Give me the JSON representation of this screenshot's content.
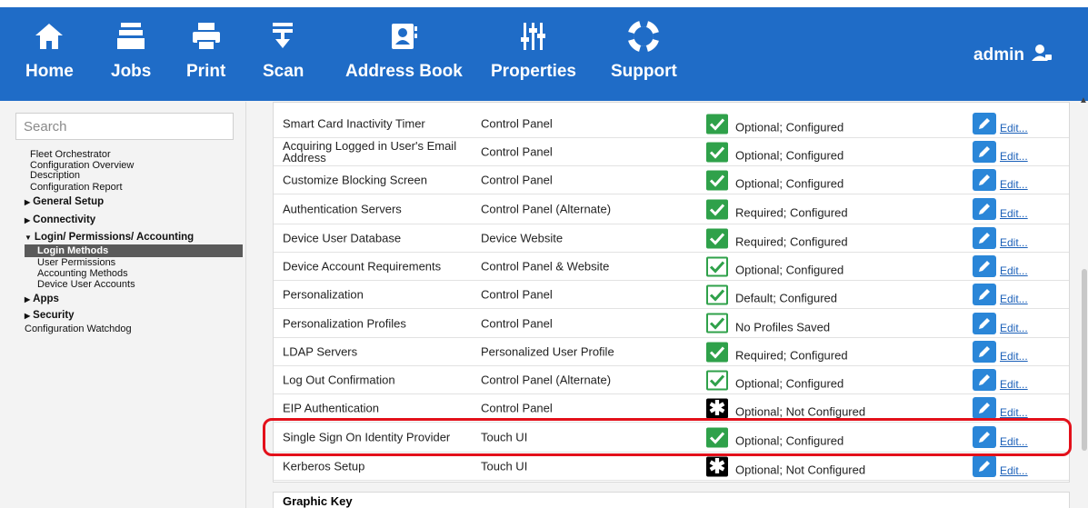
{
  "nav": {
    "items": [
      {
        "label": "Home",
        "icon": "home-icon"
      },
      {
        "label": "Jobs",
        "icon": "jobs-icon"
      },
      {
        "label": "Print",
        "icon": "print-icon"
      },
      {
        "label": "Scan",
        "icon": "scan-icon"
      },
      {
        "label": "Address Book",
        "icon": "address-book-icon"
      },
      {
        "label": "Properties",
        "icon": "properties-icon"
      },
      {
        "label": "Support",
        "icon": "support-icon"
      }
    ],
    "user": "admin"
  },
  "sidebar": {
    "search_placeholder": "Search",
    "items": [
      "Fleet Orchestrator",
      "Configuration Overview",
      "Description",
      "Configuration Report",
      "General Setup",
      "Connectivity",
      "Login/ Permissions/ Accounting",
      "Login Methods",
      "User Permissions",
      "Accounting Methods",
      "Device User Accounts",
      "Apps",
      "Security",
      "Configuration Watchdog"
    ]
  },
  "table": {
    "rows": [
      {
        "name": "Smart Card Inactivity Timer",
        "location": "Control Panel",
        "status": "Optional; Configured",
        "icon": "check-filled",
        "edit": "Edit..."
      },
      {
        "name": "Acquiring Logged in User's Email Address",
        "location": "Control Panel",
        "status": "Optional; Configured",
        "icon": "check-filled",
        "edit": "Edit..."
      },
      {
        "name": "Customize Blocking Screen",
        "location": "Control Panel",
        "status": "Optional; Configured",
        "icon": "check-filled",
        "edit": "Edit..."
      },
      {
        "name": "Authentication Servers",
        "location": "Control Panel (Alternate)",
        "status": "Required; Configured",
        "icon": "check-filled",
        "edit": "Edit..."
      },
      {
        "name": "Device User Database",
        "location": "Device Website",
        "status": "Required; Configured",
        "icon": "check-filled",
        "edit": "Edit..."
      },
      {
        "name": "Device Account Requirements",
        "location": "Control Panel & Website",
        "status": "Optional; Configured",
        "icon": "check-outline",
        "edit": "Edit..."
      },
      {
        "name": "Personalization",
        "location": "Control Panel",
        "status": "Default; Configured",
        "icon": "check-outline",
        "edit": "Edit..."
      },
      {
        "name": "Personalization Profiles",
        "location": "Control Panel",
        "status": "No Profiles Saved",
        "icon": "check-outline",
        "edit": "Edit..."
      },
      {
        "name": "LDAP Servers",
        "location": "Personalized User Profile",
        "status": "Required; Configured",
        "icon": "check-filled",
        "edit": "Edit..."
      },
      {
        "name": "Log Out Confirmation",
        "location": "Control Panel (Alternate)",
        "status": "Optional; Configured",
        "icon": "check-outline",
        "edit": "Edit..."
      },
      {
        "name": "EIP Authentication",
        "location": "Control Panel",
        "status": "Optional; Not Configured",
        "icon": "star-icon",
        "edit": "Edit..."
      },
      {
        "name": "Single Sign On Identity Provider",
        "location": "Touch UI",
        "status": "Optional; Configured",
        "icon": "check-filled",
        "edit": "Edit..."
      },
      {
        "name": "Kerberos Setup",
        "location": "Touch UI",
        "status": "Optional; Not Configured",
        "icon": "star-icon",
        "edit": "Edit..."
      }
    ]
  },
  "graphic_key": "Graphic Key",
  "colors": {
    "nav_bg": "#1f6cc7",
    "check": "#2fa14a",
    "highlight": "#e3101a",
    "edit_icon": "#2a86d8"
  }
}
